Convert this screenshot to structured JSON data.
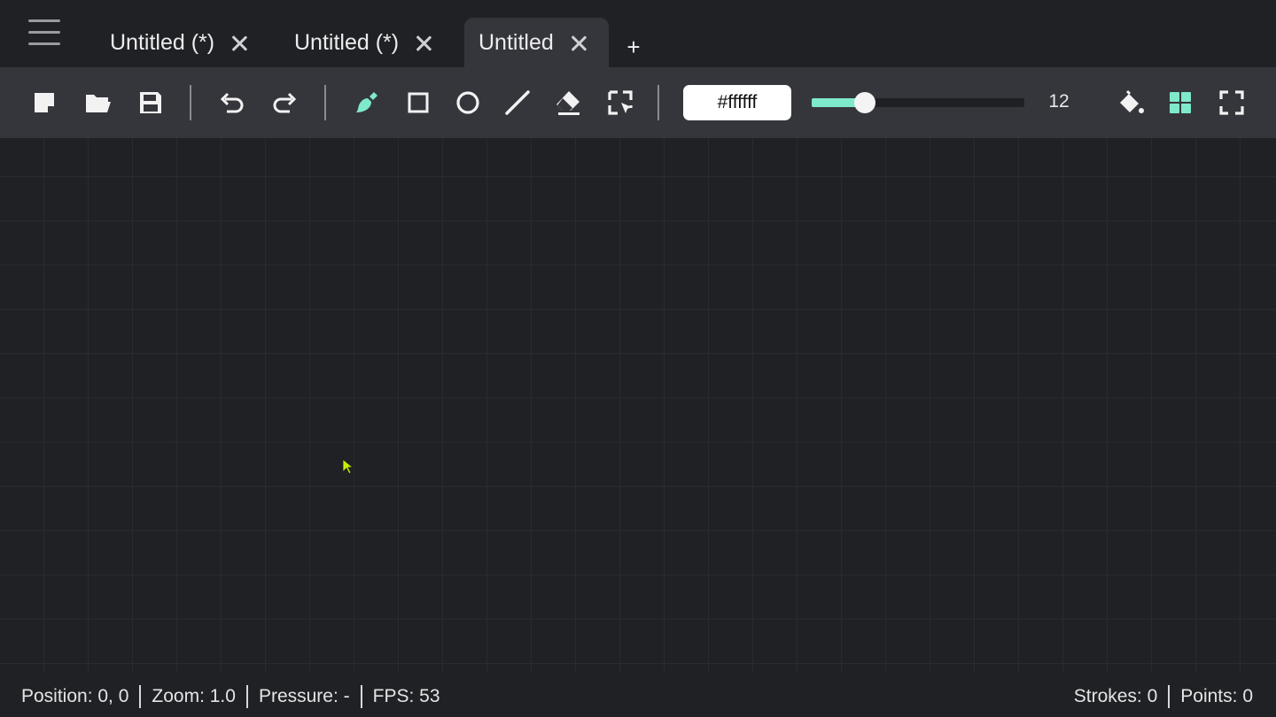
{
  "tabs": [
    {
      "label": "Untitled (*)",
      "active": false
    },
    {
      "label": "Untitled (*)",
      "active": false
    },
    {
      "label": "Untitled",
      "active": true
    }
  ],
  "add_tab_label": "+",
  "toolbar": {
    "file_tools": [
      "new-file-icon",
      "open-folder-icon",
      "save-icon"
    ],
    "history_tools": [
      "undo-icon",
      "redo-icon"
    ],
    "draw_tools": [
      "brush-icon",
      "rectangle-icon",
      "circle-icon",
      "line-icon",
      "eraser-icon",
      "selection-icon"
    ],
    "active_tool": "brush-icon",
    "color_value": "#ffffff",
    "brush_size": "12",
    "brush_size_fraction": 0.25,
    "right_tools": [
      "fill-bucket-icon",
      "grid-icon",
      "fullscreen-icon"
    ]
  },
  "status": {
    "position": "Position: 0, 0",
    "zoom": "Zoom: 1.0",
    "pressure": "Pressure: -",
    "fps": "FPS: 53",
    "strokes": "Strokes: 0",
    "points": "Points: 0"
  },
  "colors": {
    "accent": "#7fe9cc",
    "background": "#202124",
    "toolbar": "#35363b",
    "cursor": "#c8f000"
  }
}
